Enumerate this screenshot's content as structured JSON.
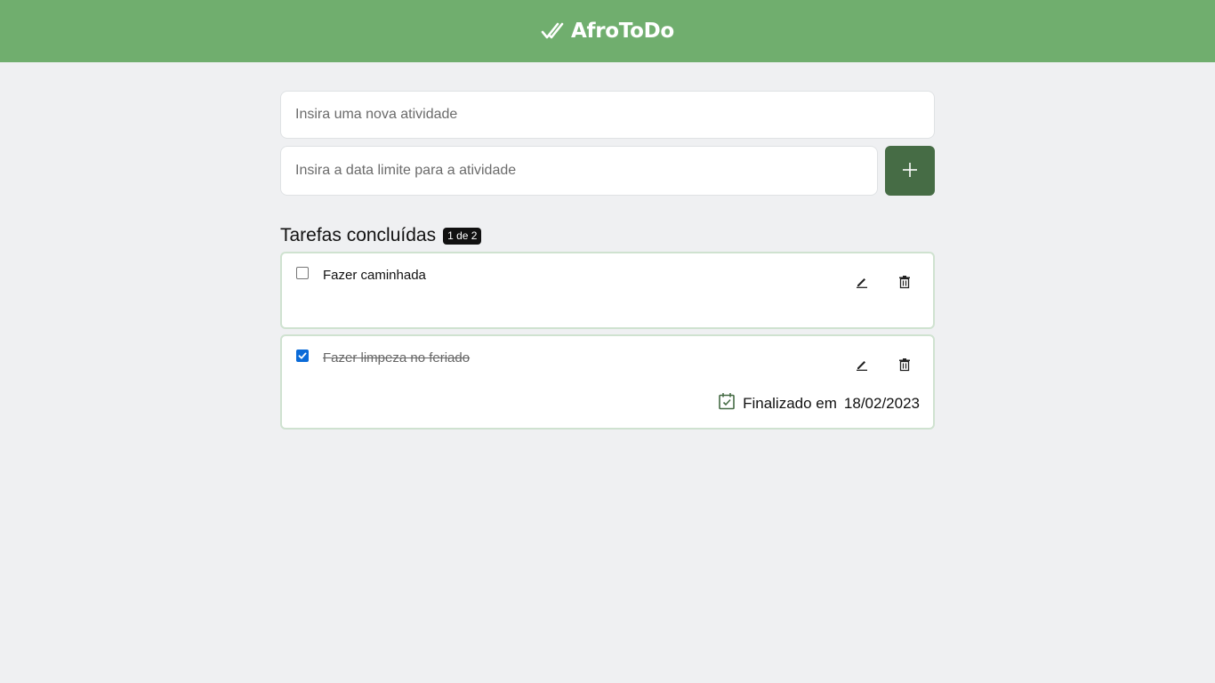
{
  "header": {
    "title": "AfroToDo",
    "logo_icon": "double-check-icon"
  },
  "form": {
    "task_placeholder": "Insira uma nova atividade",
    "date_placeholder": "Insira a data limite para a atividade",
    "add_icon": "plus-icon"
  },
  "section": {
    "title": "Tarefas concluídas",
    "badge": "1 de 2"
  },
  "tasks": [
    {
      "text": "Fazer caminhada",
      "checked": false
    },
    {
      "text": "Fazer limpeza no feriado",
      "checked": true,
      "finished_label": "Finalizado em",
      "finished_date": "18/02/2023"
    }
  ],
  "colors": {
    "header": "#70ae6e",
    "add_button": "#466c45",
    "checkbox_checked": "#0b6bd8",
    "task_border": "#cfe2d0",
    "background": "#eff0f2"
  }
}
